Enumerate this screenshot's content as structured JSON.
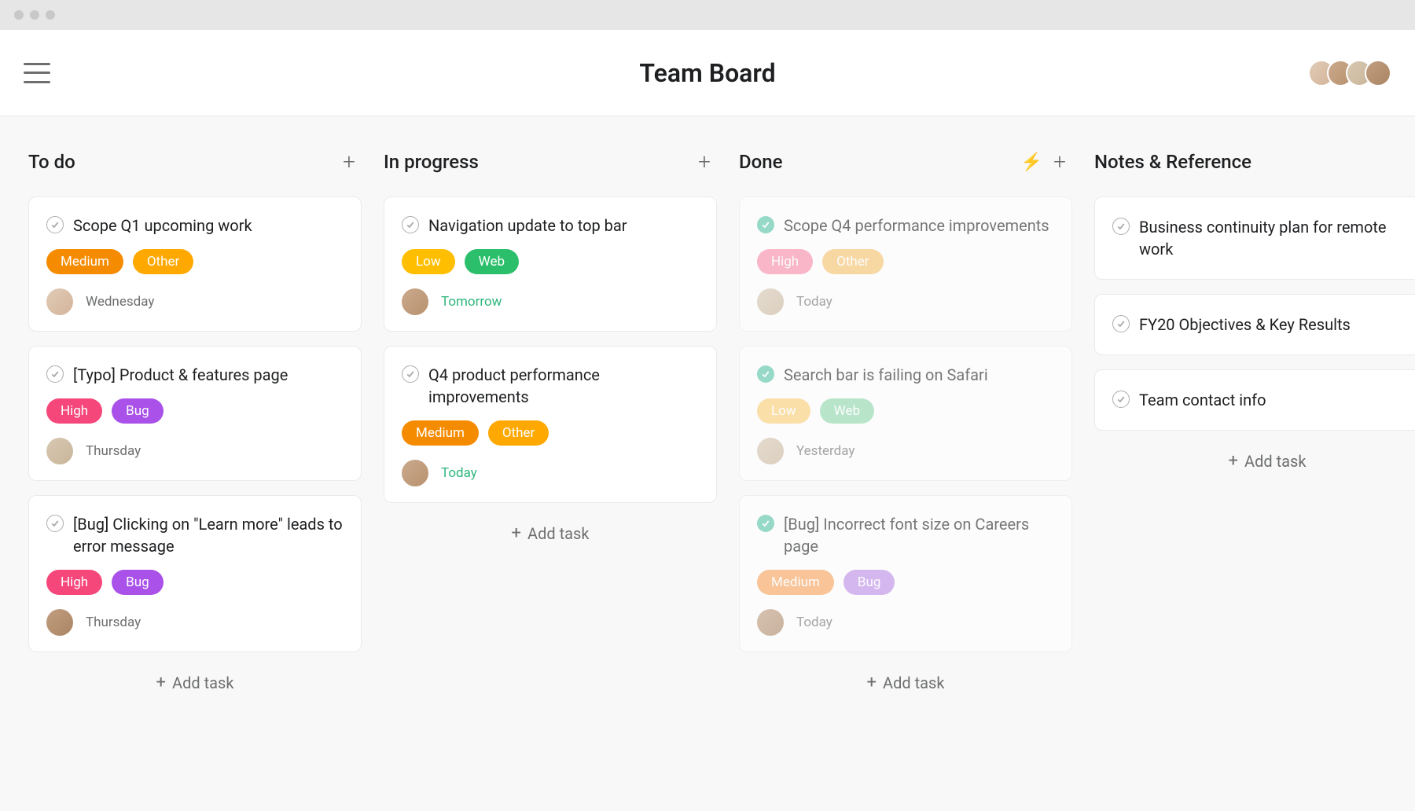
{
  "header": {
    "title": "Team Board",
    "avatars": [
      "person-1",
      "person-2",
      "person-3",
      "person-4"
    ]
  },
  "add_task_label": "Add task",
  "tag_colors": {
    "Medium": "#f58b00",
    "Other": "#ffa800",
    "Low": "#ffbe00",
    "Web": "#2bbf6b",
    "High": "#f6477b",
    "Bug": "#a951e8",
    "Medium_faded": "#f9a35a",
    "Other_faded": "#f7c36c",
    "Low_faded": "#fcd174",
    "Web_faded": "#8fd9ad",
    "High_faded": "#f88ba9",
    "Bug_faded": "#bd8de9"
  },
  "columns": [
    {
      "title": "To do",
      "has_lightning": false,
      "cards": [
        {
          "title": "Scope Q1 upcoming work",
          "done": false,
          "tags": [
            {
              "label": "Medium",
              "color": "Medium"
            },
            {
              "label": "Other",
              "color": "Other"
            }
          ],
          "avatar": "c1",
          "due": "Wednesday",
          "due_style": ""
        },
        {
          "title": "[Typo] Product & features page",
          "done": false,
          "tags": [
            {
              "label": "High",
              "color": "High"
            },
            {
              "label": "Bug",
              "color": "Bug"
            }
          ],
          "avatar": "c3",
          "due": "Thursday",
          "due_style": ""
        },
        {
          "title": "[Bug] Clicking on \"Learn more\" leads to error message",
          "done": false,
          "tags": [
            {
              "label": "High",
              "color": "High"
            },
            {
              "label": "Bug",
              "color": "Bug"
            }
          ],
          "avatar": "c4",
          "due": "Thursday",
          "due_style": ""
        }
      ]
    },
    {
      "title": "In progress",
      "has_lightning": false,
      "cards": [
        {
          "title": "Navigation update to top bar",
          "done": false,
          "tags": [
            {
              "label": "Low",
              "color": "Low"
            },
            {
              "label": "Web",
              "color": "Web"
            }
          ],
          "avatar": "c2",
          "due": "Tomorrow",
          "due_style": "green"
        },
        {
          "title": "Q4 product performance improvements",
          "done": false,
          "tags": [
            {
              "label": "Medium",
              "color": "Medium"
            },
            {
              "label": "Other",
              "color": "Other"
            }
          ],
          "avatar": "c2",
          "due": "Today",
          "due_style": "green"
        }
      ]
    },
    {
      "title": "Done",
      "has_lightning": true,
      "cards": [
        {
          "title": "Scope Q4 performance improvements",
          "done": true,
          "faded": true,
          "tags": [
            {
              "label": "High",
              "color": "High_faded"
            },
            {
              "label": "Other",
              "color": "Other_faded"
            }
          ],
          "avatar": "c3",
          "due": "Today",
          "due_style": ""
        },
        {
          "title": "Search bar is failing on Safari",
          "done": true,
          "faded": true,
          "tags": [
            {
              "label": "Low",
              "color": "Low_faded"
            },
            {
              "label": "Web",
              "color": "Web_faded"
            }
          ],
          "avatar": "c3",
          "due": "Yesterday",
          "due_style": ""
        },
        {
          "title": "[Bug] Incorrect font size on Careers page",
          "done": true,
          "faded": true,
          "tags": [
            {
              "label": "Medium",
              "color": "Medium_faded"
            },
            {
              "label": "Bug",
              "color": "Bug_faded"
            }
          ],
          "avatar": "c4",
          "due": "Today",
          "due_style": ""
        }
      ]
    },
    {
      "title": "Notes & Reference",
      "has_lightning": false,
      "no_plus": true,
      "cards": [
        {
          "title": "Business continuity plan for remote work",
          "done": false,
          "simple": true
        },
        {
          "title": "FY20 Objectives & Key Results",
          "done": false,
          "simple": true
        },
        {
          "title": "Team contact info",
          "done": false,
          "simple": true
        }
      ]
    }
  ]
}
